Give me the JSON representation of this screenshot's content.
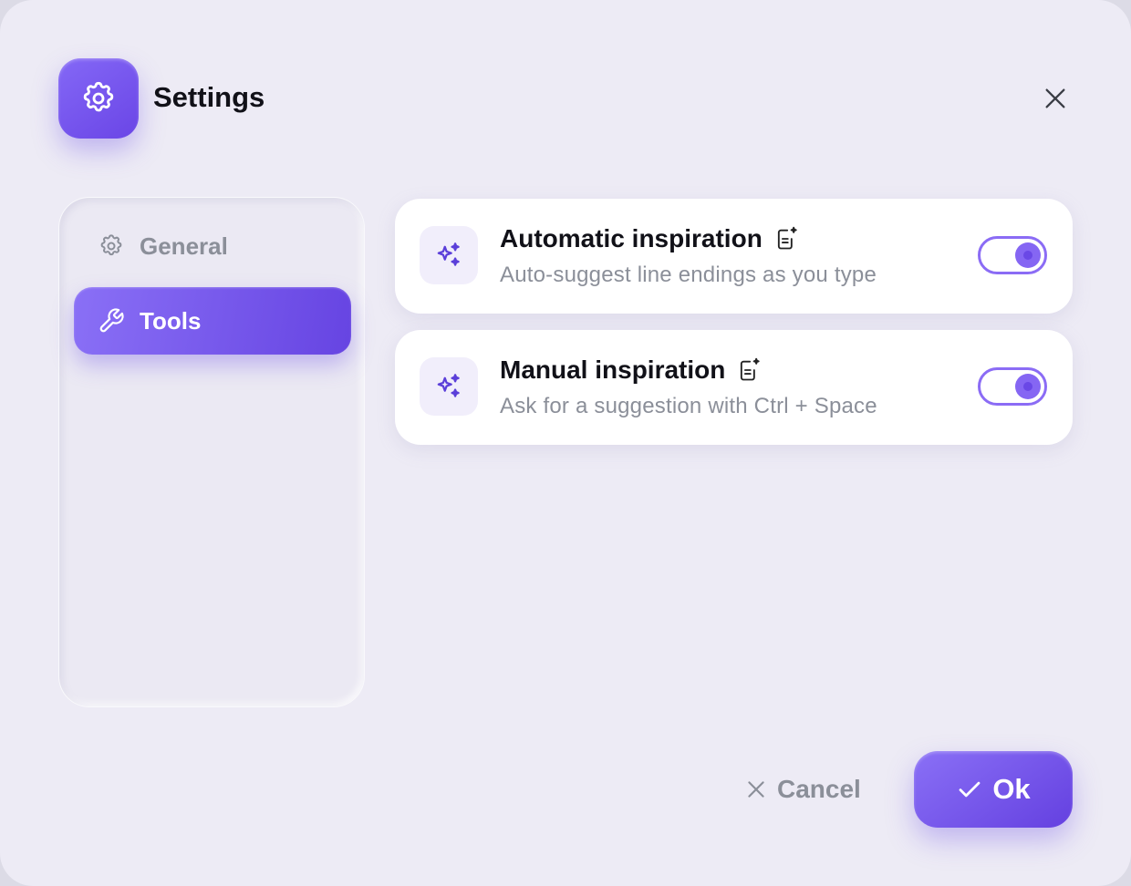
{
  "header": {
    "title": "Settings",
    "icon": "gear-icon",
    "close_icon": "close-icon"
  },
  "sidebar": {
    "items": [
      {
        "label": "General",
        "icon": "gear-icon",
        "active": false
      },
      {
        "label": "Tools",
        "icon": "wrench-icon",
        "active": true
      }
    ]
  },
  "settings": [
    {
      "title": "Automatic inspiration",
      "subtitle": "Auto-suggest line endings as you type",
      "icon": "sparkles-icon",
      "badge_icon": "document-sparkle-icon",
      "enabled": true
    },
    {
      "title": "Manual inspiration",
      "subtitle": "Ask for a suggestion with Ctrl + Space",
      "icon": "sparkles-icon",
      "badge_icon": "document-sparkle-icon",
      "enabled": true
    }
  ],
  "footer": {
    "cancel_label": "Cancel",
    "ok_label": "Ok"
  },
  "colors": {
    "accent": "#7456ee",
    "background": "#edebf5",
    "muted_text": "#8b8f99"
  }
}
